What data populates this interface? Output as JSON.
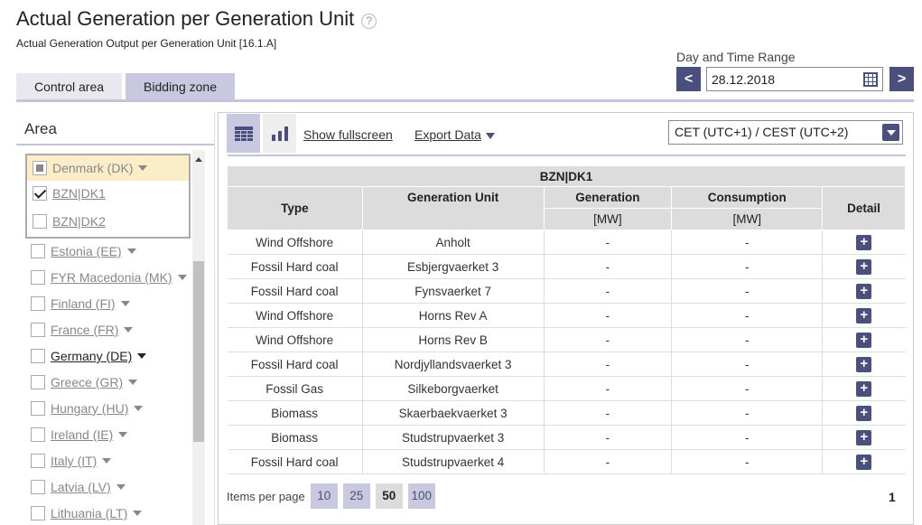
{
  "header": {
    "title": "Actual Generation per Generation Unit",
    "help_icon": "?",
    "subtitle": "Actual Generation Output per Generation Unit [16.1.A]"
  },
  "date_range": {
    "label": "Day and Time Range",
    "prev": "<",
    "next": ">",
    "value": "28.12.2018"
  },
  "tabs": [
    {
      "label": "Control area",
      "active": false
    },
    {
      "label": "Bidding zone",
      "active": true
    }
  ],
  "area": {
    "title": "Area",
    "group": {
      "label": "Denmark (DK)",
      "state": "indeterminate"
    },
    "group_children": [
      {
        "label": "BZN|DK1",
        "checked": true
      },
      {
        "label": "BZN|DK2",
        "checked": false
      }
    ],
    "items": [
      {
        "label": "Estonia (EE)"
      },
      {
        "label": "FYR Macedonia (MK)"
      },
      {
        "label": "Finland (FI)"
      },
      {
        "label": "France (FR)"
      },
      {
        "label": "Germany (DE)"
      },
      {
        "label": "Greece (GR)"
      },
      {
        "label": "Hungary (HU)"
      },
      {
        "label": "Ireland (IE)"
      },
      {
        "label": "Italy (IT)"
      },
      {
        "label": "Latvia (LV)"
      },
      {
        "label": "Lithuania (LT)"
      }
    ]
  },
  "toolbar": {
    "fullscreen": "Show fullscreen",
    "export": "Export Data",
    "timezone": "CET (UTC+1) / CEST (UTC+2)"
  },
  "table": {
    "zone": "BZN|DK1",
    "headers": {
      "type": "Type",
      "unit": "Generation Unit",
      "generation": "Generation",
      "consumption": "Consumption",
      "unit_mw": "[MW]",
      "detail": "Detail"
    },
    "rows": [
      {
        "type": "Wind Offshore",
        "unit": "Anholt",
        "generation": "-",
        "consumption": "-"
      },
      {
        "type": "Fossil Hard coal",
        "unit": "Esbjergvaerket 3",
        "generation": "-",
        "consumption": "-"
      },
      {
        "type": "Fossil Hard coal",
        "unit": "Fynsvaerket 7",
        "generation": "-",
        "consumption": "-"
      },
      {
        "type": "Wind Offshore",
        "unit": "Horns Rev A",
        "generation": "-",
        "consumption": "-"
      },
      {
        "type": "Wind Offshore",
        "unit": "Horns Rev B",
        "generation": "-",
        "consumption": "-"
      },
      {
        "type": "Fossil Hard coal",
        "unit": "Nordjyllandsvaerket 3",
        "generation": "-",
        "consumption": "-"
      },
      {
        "type": "Fossil Gas",
        "unit": "Silkeborgvaerket",
        "generation": "-",
        "consumption": "-"
      },
      {
        "type": "Biomass",
        "unit": "Skaerbaekvaerket 3",
        "generation": "-",
        "consumption": "-"
      },
      {
        "type": "Biomass",
        "unit": "Studstrupvaerket 3",
        "generation": "-",
        "consumption": "-"
      },
      {
        "type": "Fossil Hard coal",
        "unit": "Studstrupvaerket 4",
        "generation": "-",
        "consumption": "-"
      }
    ],
    "detail_symbol": "+"
  },
  "pager": {
    "label": "Items per page",
    "options": [
      "10",
      "25",
      "50",
      "100"
    ],
    "selected": "50",
    "page": "1"
  },
  "colors": {
    "accent": "#4b4f7c",
    "tab_active": "#c8c8e0",
    "highlight": "#fcedc9"
  }
}
